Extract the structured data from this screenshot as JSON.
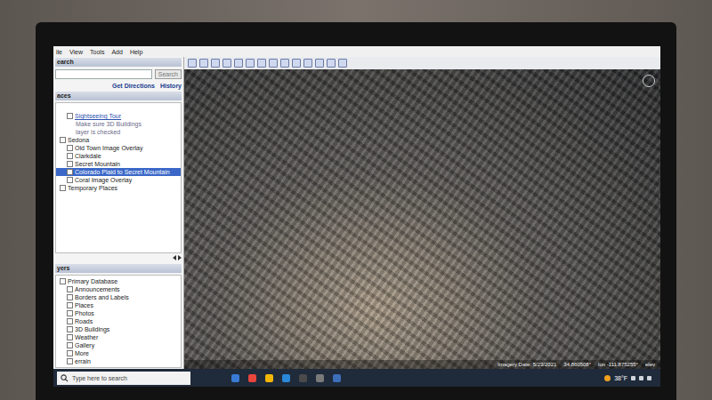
{
  "menu": [
    {
      "label": "ile"
    },
    {
      "label": "View"
    },
    {
      "label": "Tools"
    },
    {
      "label": "Add"
    },
    {
      "label": "Help"
    }
  ],
  "search": {
    "header": "earch",
    "button": "Search",
    "links": [
      "Get Directions",
      "History"
    ]
  },
  "places": {
    "header": "aces",
    "items": [
      {
        "label": "Sightseeing Tour",
        "kind": "link",
        "selected": false
      },
      {
        "label": "Make sure 3D Buildings",
        "kind": "note",
        "selected": false
      },
      {
        "label": "layer is checked",
        "kind": "note",
        "selected": false
      },
      {
        "label": "Sedona",
        "kind": "folder",
        "selected": false
      },
      {
        "label": "Old Town Image Overlay",
        "kind": "item",
        "selected": false
      },
      {
        "label": "Clarkdale",
        "kind": "item",
        "selected": false
      },
      {
        "label": "Secret Mountain",
        "kind": "item",
        "selected": false
      },
      {
        "label": "Colorado Plaid to Secret Mountain",
        "kind": "item",
        "selected": true
      },
      {
        "label": "Coral Image Overlay",
        "kind": "item",
        "selected": false
      },
      {
        "label": "Temporary Places",
        "kind": "folder",
        "selected": false
      }
    ]
  },
  "layers": {
    "header": "yers",
    "items": [
      {
        "label": "Primary Database",
        "kind": "folder"
      },
      {
        "label": "Announcements",
        "kind": "item"
      },
      {
        "label": "Borders and Labels",
        "kind": "item"
      },
      {
        "label": "Places",
        "kind": "item"
      },
      {
        "label": "Photos",
        "kind": "item"
      },
      {
        "label": "Roads",
        "kind": "item"
      },
      {
        "label": "3D Buildings",
        "kind": "item"
      },
      {
        "label": "Weather",
        "kind": "item"
      },
      {
        "label": "Gallery",
        "kind": "item"
      },
      {
        "label": "More",
        "kind": "item"
      },
      {
        "label": "errain",
        "kind": "item"
      }
    ]
  },
  "map": {
    "status": [
      "Imagery Date: 5/23/2021",
      "34.860508°",
      "lon -111.875255°",
      "elev"
    ]
  },
  "taskbar": {
    "search_placeholder": "Type here to search",
    "weather": "38°F"
  }
}
